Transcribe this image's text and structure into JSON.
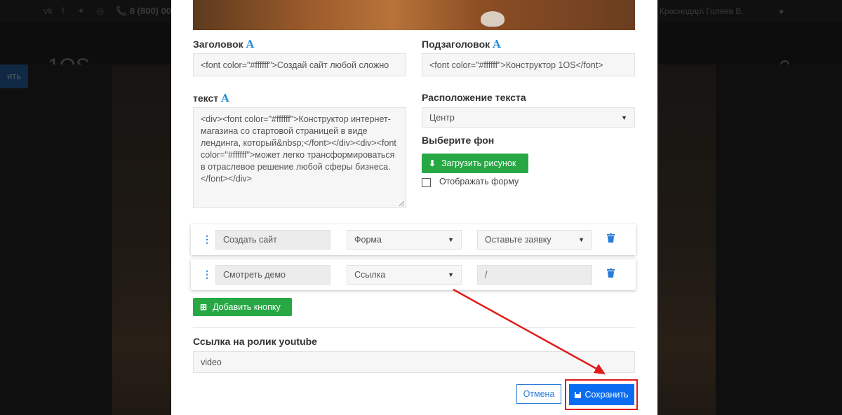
{
  "background": {
    "phone": "8 (800) 00",
    "city_user": "Краснодар\\ Голяев В.",
    "logo_text": "1OS",
    "side_button": "ить"
  },
  "modal": {
    "heading_label": "Заголовок",
    "heading_value": "<font color=\"#ffffff\">Создай сайт любой сложно",
    "subheading_label": "Подзаголовок",
    "subheading_value": "<font color=\"#ffffff\">Конструктор 1OS</font>",
    "text_label": "текст",
    "text_value": "<div><font color=\"#ffffff\">Конструктор интернет-магазина со стартовой страницей в виде лендинга, который&nbsp;</font></div><div><font color=\"#ffffff\">может легко трансформироваться в отраслевое решение любой сферы бизнеса.</font></div>",
    "text_position_label": "Расположение текста",
    "text_position_value": "Центр",
    "background_label": "Выберите фон",
    "upload_button": "Загрузить рисунок",
    "show_form_label": "Отображать форму",
    "show_form_checked": false,
    "buttons": [
      {
        "text": "Создать сайт",
        "type": "Форма",
        "target": "Оставьте заявку"
      },
      {
        "text": "Смотреть демо",
        "type": "Ссылка",
        "target": "/"
      }
    ],
    "add_button": "Добавить кнопку",
    "youtube_label": "Ссылка на ролик youtube",
    "youtube_placeholder": "video",
    "cancel_button": "Отмена",
    "save_button": "Сохранить",
    "accent_colors": {
      "primary": "#0a6df1",
      "success": "#27a844",
      "annotation": "#e11b1b"
    }
  }
}
